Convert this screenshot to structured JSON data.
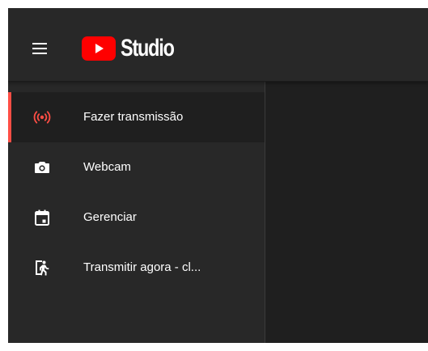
{
  "header": {
    "logo_text": "Studio"
  },
  "sidebar": {
    "items": [
      {
        "label": "Fazer transmissão",
        "icon": "live-broadcast-icon",
        "active": true
      },
      {
        "label": "Webcam",
        "icon": "camera-icon",
        "active": false
      },
      {
        "label": "Gerenciar",
        "icon": "calendar-icon",
        "active": false
      },
      {
        "label": "Transmitir agora - cl...",
        "icon": "exit-run-icon",
        "active": false
      }
    ]
  },
  "colors": {
    "accent": "#ff4e45",
    "header_bg": "#282828",
    "sidebar_bg": "#282828",
    "content_bg": "#1f1f1f",
    "text": "#ffffff"
  }
}
